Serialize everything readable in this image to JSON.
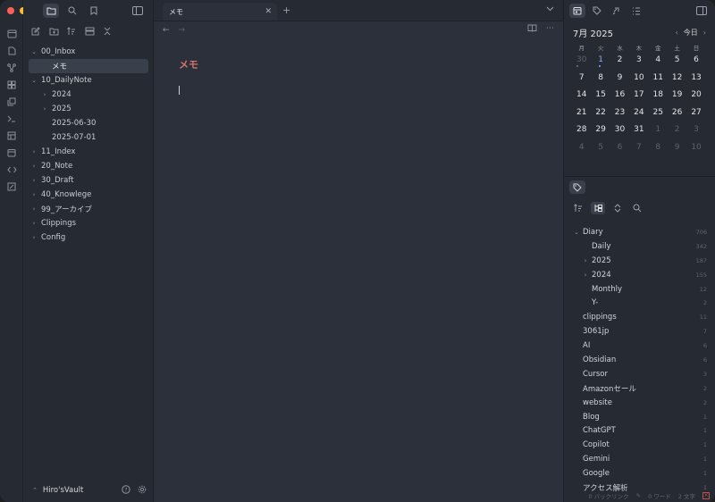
{
  "colors": {
    "close": "#ff5f57",
    "minimize": "#febc2e",
    "maximize": "#28c840",
    "accent_title": "#d4736e"
  },
  "ribbon_icons": [
    "tabs-icon",
    "file-icon",
    "graph-icon",
    "canvas-icon",
    "copy-icon",
    "terminal-icon",
    "template-icon",
    "calendar-icon",
    "code-icon",
    "percent-icon"
  ],
  "sidebar": {
    "tree": [
      {
        "label": "00_Inbox",
        "level": 0,
        "expand": "open"
      },
      {
        "label": "メモ",
        "level": 1,
        "expand": "none",
        "selected": true
      },
      {
        "label": "10_DailyNote",
        "level": 0,
        "expand": "open"
      },
      {
        "label": "2024",
        "level": 1,
        "expand": "closed"
      },
      {
        "label": "2025",
        "level": 1,
        "expand": "closed"
      },
      {
        "label": "2025-06-30",
        "level": 1,
        "expand": "none"
      },
      {
        "label": "2025-07-01",
        "level": 1,
        "expand": "none"
      },
      {
        "label": "11_Index",
        "level": 0,
        "expand": "closed"
      },
      {
        "label": "20_Note",
        "level": 0,
        "expand": "closed"
      },
      {
        "label": "30_Draft",
        "level": 0,
        "expand": "closed"
      },
      {
        "label": "40_Knowlege",
        "level": 0,
        "expand": "closed"
      },
      {
        "label": "99_アーカイブ",
        "level": 0,
        "expand": "closed"
      },
      {
        "label": "Clippings",
        "level": 0,
        "expand": "closed"
      },
      {
        "label": "Config",
        "level": 0,
        "expand": "closed"
      }
    ],
    "vault_name": "Hiro'sVault"
  },
  "main": {
    "tab_title": "メモ",
    "note_title": "メモ"
  },
  "calendar": {
    "month_label": "7月 2025",
    "today_label": "今日",
    "weekdays": [
      "月",
      "火",
      "水",
      "木",
      "金",
      "土",
      "日"
    ],
    "weeks": [
      [
        {
          "d": "30",
          "m": true,
          "dot": true
        },
        {
          "d": "1",
          "t": true,
          "dot": true
        },
        {
          "d": "2"
        },
        {
          "d": "3"
        },
        {
          "d": "4"
        },
        {
          "d": "5"
        },
        {
          "d": "6"
        }
      ],
      [
        {
          "d": "7"
        },
        {
          "d": "8"
        },
        {
          "d": "9"
        },
        {
          "d": "10"
        },
        {
          "d": "11"
        },
        {
          "d": "12"
        },
        {
          "d": "13"
        }
      ],
      [
        {
          "d": "14"
        },
        {
          "d": "15"
        },
        {
          "d": "16"
        },
        {
          "d": "17"
        },
        {
          "d": "18"
        },
        {
          "d": "19"
        },
        {
          "d": "20"
        }
      ],
      [
        {
          "d": "21"
        },
        {
          "d": "22"
        },
        {
          "d": "23"
        },
        {
          "d": "24"
        },
        {
          "d": "25"
        },
        {
          "d": "26"
        },
        {
          "d": "27"
        }
      ],
      [
        {
          "d": "28"
        },
        {
          "d": "29"
        },
        {
          "d": "30"
        },
        {
          "d": "31"
        },
        {
          "d": "1",
          "m": true
        },
        {
          "d": "2",
          "m": true
        },
        {
          "d": "3",
          "m": true
        }
      ],
      [
        {
          "d": "4",
          "m": true
        },
        {
          "d": "5",
          "m": true
        },
        {
          "d": "6",
          "m": true
        },
        {
          "d": "7",
          "m": true
        },
        {
          "d": "8",
          "m": true
        },
        {
          "d": "9",
          "m": true
        },
        {
          "d": "10",
          "m": true
        }
      ]
    ]
  },
  "tags": [
    {
      "label": "Diary",
      "count": "706",
      "level": 0,
      "expand": "open"
    },
    {
      "label": "Daily",
      "count": "342",
      "level": 1,
      "expand": "none"
    },
    {
      "label": "2025",
      "count": "187",
      "level": 1,
      "expand": "closed"
    },
    {
      "label": "2024",
      "count": "155",
      "level": 1,
      "expand": "closed"
    },
    {
      "label": "Monthly",
      "count": "12",
      "level": 1,
      "expand": "none"
    },
    {
      "label": "Y-",
      "count": "2",
      "level": 1,
      "expand": "none"
    },
    {
      "label": "clippings",
      "count": "11",
      "level": 0,
      "expand": "none"
    },
    {
      "label": "3061jp",
      "count": "7",
      "level": 0,
      "expand": "none"
    },
    {
      "label": "AI",
      "count": "6",
      "level": 0,
      "expand": "none"
    },
    {
      "label": "Obsidian",
      "count": "6",
      "level": 0,
      "expand": "none"
    },
    {
      "label": "Cursor",
      "count": "3",
      "level": 0,
      "expand": "none"
    },
    {
      "label": "Amazonセール",
      "count": "2",
      "level": 0,
      "expand": "none"
    },
    {
      "label": "website",
      "count": "2",
      "level": 0,
      "expand": "none"
    },
    {
      "label": "Blog",
      "count": "1",
      "level": 0,
      "expand": "none"
    },
    {
      "label": "ChatGPT",
      "count": "1",
      "level": 0,
      "expand": "none"
    },
    {
      "label": "Copilot",
      "count": "1",
      "level": 0,
      "expand": "none"
    },
    {
      "label": "Gemini",
      "count": "1",
      "level": 0,
      "expand": "none"
    },
    {
      "label": "Google",
      "count": "1",
      "level": 0,
      "expand": "none"
    },
    {
      "label": "アクセス解析",
      "count": "1",
      "level": 0,
      "expand": "none"
    }
  ],
  "status": {
    "backlinks": "0 バックリンク",
    "words": "0 ワード",
    "chars": "2 文字"
  }
}
